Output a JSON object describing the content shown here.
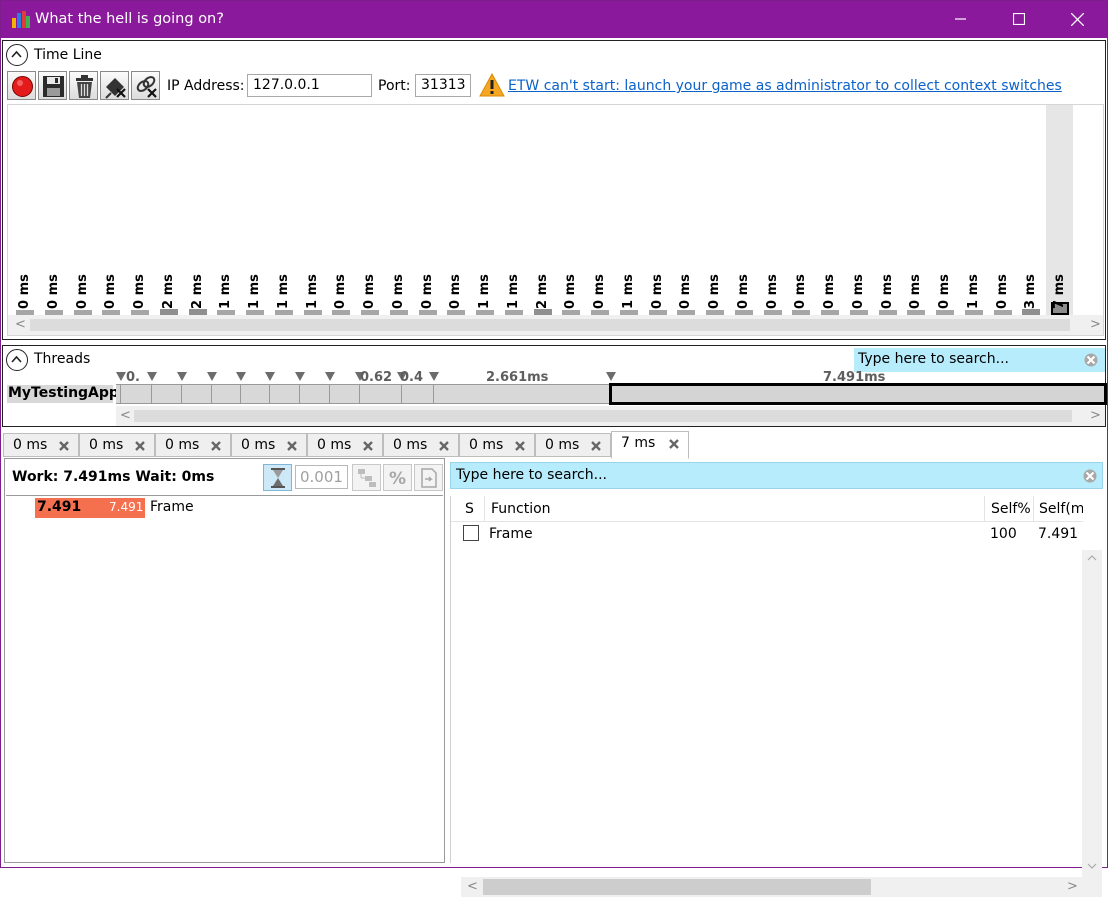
{
  "window": {
    "title": "What the hell is going on?",
    "minimize_icon": "minimize-icon",
    "maximize_icon": "maximize-icon",
    "close_icon": "close-icon"
  },
  "timeline": {
    "section_label": "Time Line",
    "toolbar": {
      "buttons": [
        "record-icon",
        "save-icon",
        "trash-icon",
        "disconnect-icon",
        "disconnect-link-icon"
      ],
      "ip_label": "IP Address:",
      "ip_value": "127.0.0.1",
      "port_label": "Port:",
      "port_value": "31313",
      "warning_icon": "warning-icon",
      "etw_message": "ETW can't start: launch your game as administrator to collect context switches"
    },
    "frames": [
      "0 ms",
      "0 ms",
      "0 ms",
      "0 ms",
      "0 ms",
      "2 ms",
      "2 ms",
      "1 ms",
      "1 ms",
      "1 ms",
      "1 ms",
      "0 ms",
      "0 ms",
      "0 ms",
      "0 ms",
      "0 ms",
      "1 ms",
      "1 ms",
      "2 ms",
      "0 ms",
      "0 ms",
      "1 ms",
      "0 ms",
      "0 ms",
      "0 ms",
      "0 ms",
      "0 ms",
      "0 ms",
      "0 ms",
      "0 ms",
      "0 ms",
      "0 ms",
      "0 ms",
      "1 ms",
      "0 ms",
      "3 ms",
      "7 ms"
    ],
    "selected_frame_index": 36
  },
  "threads": {
    "section_label": "Threads",
    "search_placeholder": "Type here to search...",
    "thread_name": "MyTestingApp",
    "event_labels": [
      "0.",
      "0.62",
      "0.4",
      "2.661ms",
      "7.491ms"
    ]
  },
  "tabs": [
    {
      "label": "0 ms",
      "active": false
    },
    {
      "label": "0 ms",
      "active": false
    },
    {
      "label": "0 ms",
      "active": false
    },
    {
      "label": "0 ms",
      "active": false
    },
    {
      "label": "0 ms",
      "active": false
    },
    {
      "label": "0 ms",
      "active": false
    },
    {
      "label": "0 ms",
      "active": false
    },
    {
      "label": "0 ms",
      "active": false
    },
    {
      "label": "7 ms",
      "active": true
    }
  ],
  "sampling": {
    "summary": "Work: 7.491ms   Wait: 0ms",
    "threshold_value": "0.001",
    "tree_row": {
      "value": "7.491",
      "value_bar": "7.491",
      "name": "Frame"
    }
  },
  "functions": {
    "search_placeholder": "Type here to search...",
    "columns": [
      "S",
      "Function",
      "Self%",
      "Self(m"
    ],
    "rows": [
      {
        "function": "Frame",
        "self_pct": "100",
        "self_ms": "7.491"
      }
    ]
  },
  "colors": {
    "titlebar": "#8a1a9b",
    "search_bg": "#b7ecfc",
    "link": "#0b62c9",
    "tree_bar": "#f4704f"
  }
}
